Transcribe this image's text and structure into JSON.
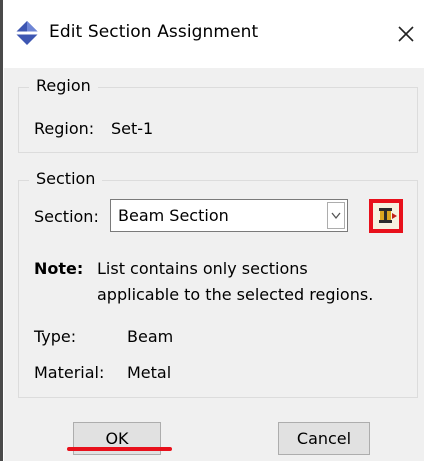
{
  "window": {
    "title": "Edit Section Assignment",
    "app_icon": "abaqus-diamond-icon",
    "close_icon": "close-icon"
  },
  "region_group": {
    "legend": "Region",
    "label": "Region:",
    "value": "Set-1"
  },
  "section_group": {
    "legend": "Section",
    "section_label": "Section:",
    "section_selected": "Beam Section",
    "create_icon": "create-section-icon",
    "highlight_color": "#e8101b",
    "note_label": "Note:",
    "note_line1": "List contains only sections",
    "note_line2": "applicable to the selected regions.",
    "type_label": "Type:",
    "type_value": "Beam",
    "material_label": "Material:",
    "material_value": "Metal"
  },
  "buttons": {
    "ok": "OK",
    "cancel": "Cancel"
  }
}
